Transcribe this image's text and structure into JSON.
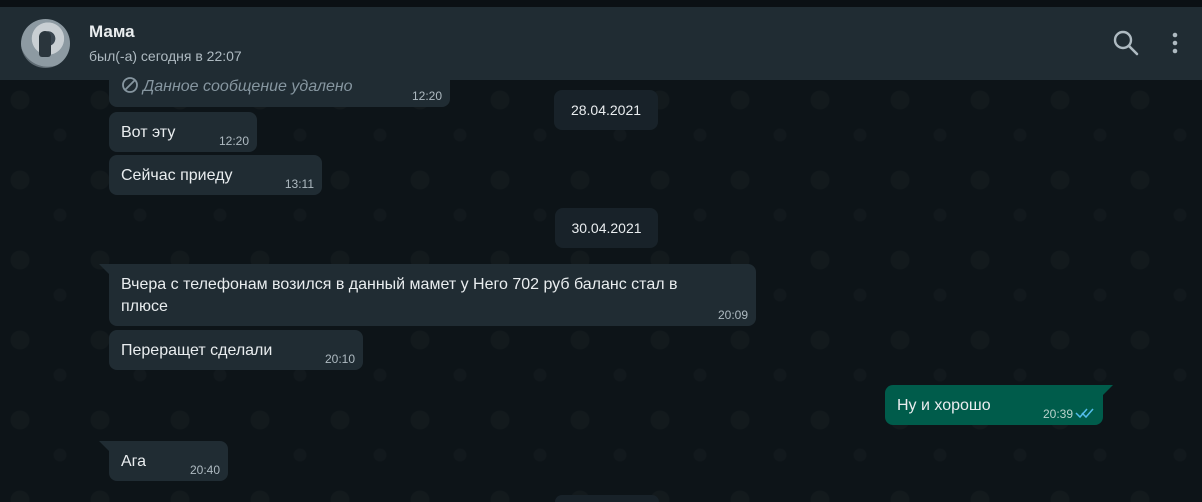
{
  "header": {
    "contact_name": "Мама",
    "status": "был(-а) сегодня в 22:07",
    "search_icon": "search-icon",
    "menu_icon": "more-vertical-icon"
  },
  "messages": {
    "deleted": {
      "text": "Данное сообщение удалено",
      "time": "12:20",
      "icon": "deleted-icon"
    },
    "m1": {
      "text": "Вот эту",
      "time": "12:20"
    },
    "m2": {
      "text": "Сейчас приеду",
      "time": "13:11"
    },
    "m3": {
      "text_line1": "Вчера с телефонам возился в данный мамет у Него 702 руб баланс стал в",
      "text_line2": "плюсе",
      "time": "20:09"
    },
    "m4": {
      "text": "Переращет сделали",
      "time": "20:10"
    },
    "m5": {
      "text": "Ну и хорошо",
      "time": "20:39",
      "status_icon": "double-check-icon"
    },
    "m6": {
      "text": "Ага",
      "time": "20:40"
    }
  },
  "dates": {
    "d1": "28.04.2021",
    "d2": "30.04.2021"
  },
  "colors": {
    "header_bg": "#202c33",
    "chat_bg": "#0d1418",
    "incoming_bubble": "#202c33",
    "outgoing_bubble": "#005c4b",
    "read_tick": "#53bdeb"
  }
}
